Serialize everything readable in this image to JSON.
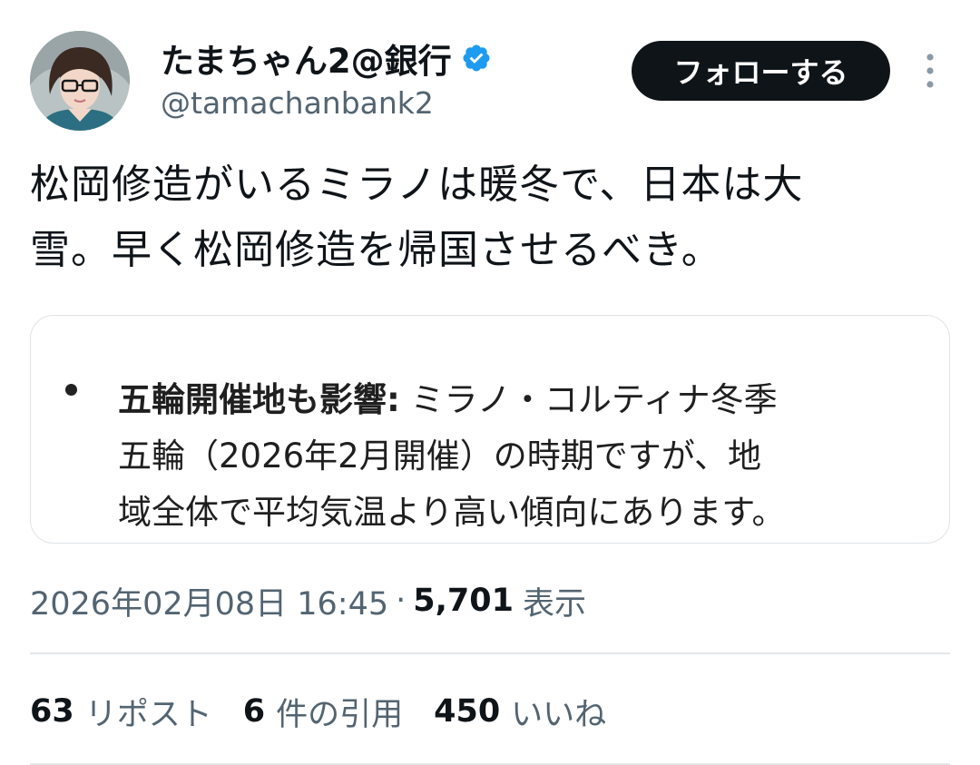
{
  "author": {
    "display_name": "たまちゃん2@銀行",
    "handle": "@tamachanbank2",
    "verified": true,
    "verified_color": "#1d9bf0",
    "avatar_icon": "avatar-woman-glasses"
  },
  "actions": {
    "follow_label": "フォローする",
    "more_icon": "more-vertical-icon"
  },
  "tweet": {
    "text_line1": "松岡修造がいるミラノは暖冬で、日本は大",
    "text_line2": "雪。早く松岡修造を帰国させるべき。"
  },
  "quote": {
    "bold_lead": "五輪開催地も影響:",
    "line1_rest": " ミラノ・コルティナ冬季",
    "line2": "五輪（2026年2月開催）の時期ですが、地",
    "line3": "域全体で平均気温より高い傾向にあります。"
  },
  "meta": {
    "timestamp": "2026年02月08日 16:45",
    "separator": "·",
    "views_count": "5,701",
    "views_label": "表示"
  },
  "stats": {
    "reposts_count": "63",
    "reposts_label": "リポスト",
    "quotes_count": "6",
    "quotes_label": "件の引用",
    "likes_count": "450",
    "likes_label": "いいね"
  },
  "colors": {
    "text_primary": "#0f1419",
    "text_secondary": "#536471",
    "button_bg": "#0f1419",
    "border": "#dfe3e7"
  }
}
